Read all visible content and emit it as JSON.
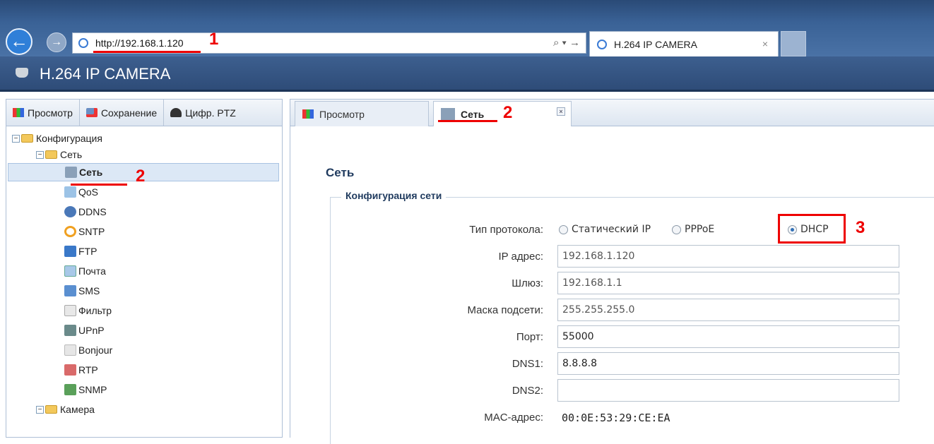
{
  "browser": {
    "url": "http://192.168.1.120",
    "tab_title": "H.264 IP CAMERA",
    "tab_close": "×",
    "back_glyph": "←",
    "forward_glyph": "→",
    "addr_tools": "⌕ ▾ →"
  },
  "annotations": {
    "a1": "1",
    "a2": "2",
    "a3": "3"
  },
  "app": {
    "title": "H.264 IP CAMERA"
  },
  "left_tabs": [
    {
      "label": "Просмотр",
      "icon": "view-icon"
    },
    {
      "label": "Сохранение",
      "icon": "save-icon"
    },
    {
      "label": "Цифр. PTZ",
      "icon": "camera-dome-icon"
    }
  ],
  "tree": {
    "config": "Конфигурация",
    "network_group": "Сеть",
    "items": [
      "Сеть",
      "QoS",
      "DDNS",
      "SNTP",
      "FTP",
      "Почта",
      "SMS",
      "Фильтр",
      "UPnP",
      "Bonjour",
      "RTP",
      "SNMP"
    ],
    "camera": "Камера",
    "toggle": "−"
  },
  "content_tabs": [
    {
      "label": "Просмотр"
    },
    {
      "label": "Сеть",
      "close": "×"
    }
  ],
  "form": {
    "heading": "Сеть",
    "section": "Конфигурация сети",
    "protocol_label": "Тип протокола:",
    "protocol_options": [
      "Статический IP",
      "PPPoE",
      "DHCP"
    ],
    "protocol_selected": "DHCP",
    "ip_label": "IP адрес:",
    "ip": "192.168.1.120",
    "gw_label": "Шлюз:",
    "gw": "192.168.1.1",
    "mask_label": "Маска подсети:",
    "mask": "255.255.255.0",
    "port_label": "Порт:",
    "port": "55000",
    "dns1_label": "DNS1:",
    "dns1": "8.8.8.8",
    "dns2_label": "DNS2:",
    "dns2": "",
    "mac_label": "MAC-адрес:",
    "mac": "00:0E:53:29:CE:EA"
  },
  "colors": {
    "annotation": "#ee0000",
    "header": "#2e4c78",
    "selected": "#dce8f6"
  }
}
